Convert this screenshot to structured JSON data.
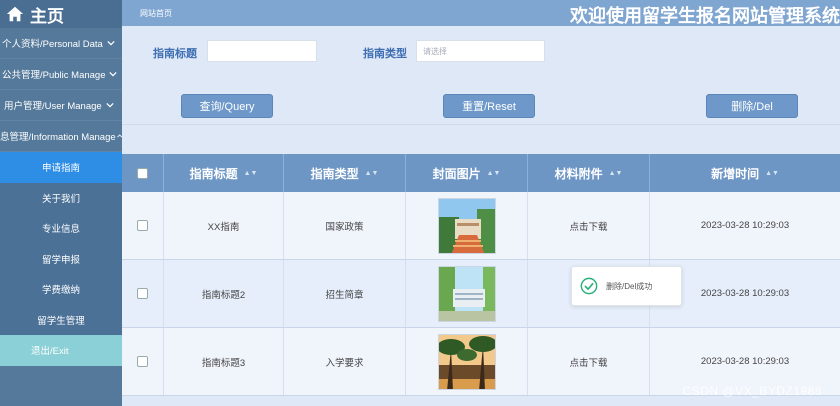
{
  "sidebar": {
    "home_label": "主页",
    "groups": [
      {
        "label": "个人资料/Personal Data"
      },
      {
        "label": "公共管理/Public Manage"
      },
      {
        "label": "用户管理/User Manage"
      },
      {
        "label": "息管理/Information Manage"
      }
    ],
    "items": [
      {
        "label": "申请指南"
      },
      {
        "label": "关于我们"
      },
      {
        "label": "专业信息"
      },
      {
        "label": "留学申报"
      },
      {
        "label": "学费缴纳"
      },
      {
        "label": "留学生管理"
      },
      {
        "label": "退出/Exit"
      }
    ]
  },
  "header": {
    "breadcrumb": "网站首页",
    "title": "欢迎使用留学生报名网站管理系统"
  },
  "search": {
    "title_label": "指南标题",
    "title_value": "",
    "type_label": "指南类型",
    "type_placeholder": "请选择",
    "query_button": "查询/Query",
    "reset_button": "重置/Reset",
    "delete_button": "删除/Del"
  },
  "table": {
    "headers": [
      "指南标题",
      "指南类型",
      "封面图片",
      "材料附件",
      "新增时间"
    ],
    "rows": [
      {
        "title": "XX指南",
        "type": "国家政策",
        "attachment": "点击下载",
        "time": "2023-03-28 10:29:03"
      },
      {
        "title": "指南标题2",
        "type": "招生简章",
        "attachment": "",
        "time": "2023-03-28 10:29:03"
      },
      {
        "title": "指南标题3",
        "type": "入学要求",
        "attachment": "点击下载",
        "time": "2023-03-28 10:29:03"
      }
    ]
  },
  "toast": {
    "message": "删除/Del成功"
  },
  "watermark": "CSDN @VX_BYDZ1988",
  "colors": {
    "sidebar": "#55799a",
    "header": "#7fa5d1",
    "active": "#2e8ee6",
    "exit": "#8bd0d6",
    "button": "#6d98c9",
    "table_header": "#6e96c5"
  }
}
